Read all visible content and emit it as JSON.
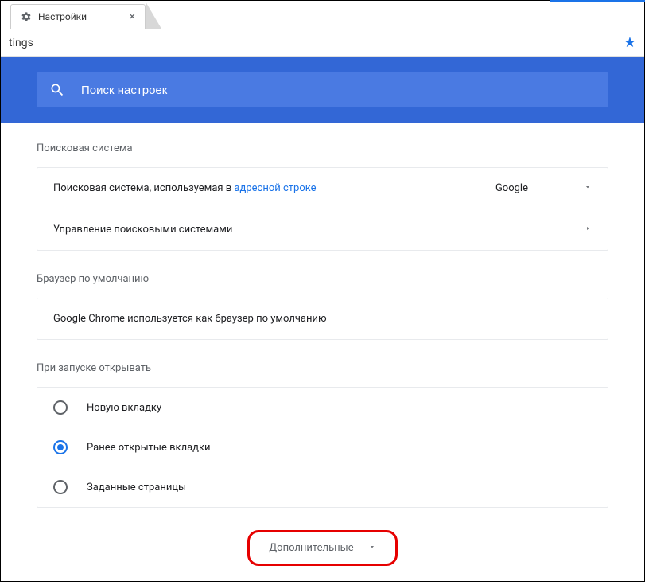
{
  "tab": {
    "title": "Настройки"
  },
  "address": {
    "text": "tings"
  },
  "search": {
    "placeholder": "Поиск настроек"
  },
  "sections": {
    "search_engine": {
      "title": "Поисковая система",
      "row1_prefix": "Поисковая система, используемая в ",
      "row1_link": "адресной строке",
      "dropdown_value": "Google",
      "row2": "Управление поисковыми системами"
    },
    "default_browser": {
      "title": "Браузер по умолчанию",
      "info": "Google Chrome используется как браузер по умолчанию"
    },
    "startup": {
      "title": "При запуске открывать",
      "opt1": "Новую вкладку",
      "opt2": "Ранее открытые вкладки",
      "opt3": "Заданные страницы"
    }
  },
  "expand_button": "Дополнительные"
}
